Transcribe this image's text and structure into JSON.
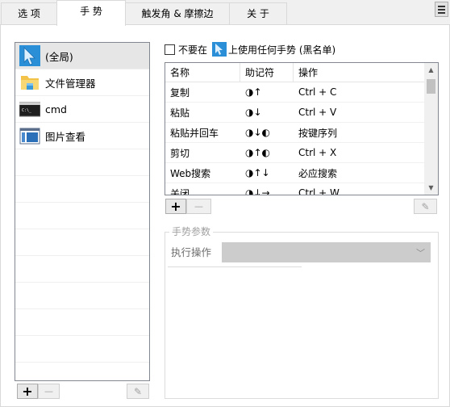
{
  "tabs": [
    {
      "label": "选 项"
    },
    {
      "label": "手 势"
    },
    {
      "label": "触发角 & 摩擦边"
    },
    {
      "label": "关 于"
    }
  ],
  "apps": [
    {
      "label": "(全局)",
      "icon": "global-cursor-icon"
    },
    {
      "label": "文件管理器",
      "icon": "folder-icon"
    },
    {
      "label": "cmd",
      "icon": "terminal-icon"
    },
    {
      "label": "图片查看",
      "icon": "image-viewer-icon"
    }
  ],
  "blacklist": {
    "prefix": "不要在",
    "suffix": "上使用任何手势 (黑名单)"
  },
  "gestures": {
    "headers": [
      "名称",
      "助记符",
      "操作"
    ],
    "rows": [
      {
        "name": "复制",
        "mnemonic": "◑↑",
        "action": "Ctrl + C"
      },
      {
        "name": "粘贴",
        "mnemonic": "◑↓",
        "action": "Ctrl + V"
      },
      {
        "name": "粘贴并回车",
        "mnemonic": "◑↓◐",
        "action": "按键序列"
      },
      {
        "name": "剪切",
        "mnemonic": "◑↑◐",
        "action": "Ctrl + X"
      },
      {
        "name": "Web搜索",
        "mnemonic": "◑↑↓",
        "action": "必应搜索"
      },
      {
        "name": "关闭",
        "mnemonic": "◑↓→",
        "action": "Ctrl + W"
      }
    ]
  },
  "buttons": {
    "add": "+",
    "remove": "—",
    "edit": "✎"
  },
  "params": {
    "title": "手势参数",
    "exec_label": "执行操作",
    "exec_value": ""
  },
  "colors": {
    "selected_row": "#e6e6e6",
    "disabled_select": "#cccccc"
  }
}
